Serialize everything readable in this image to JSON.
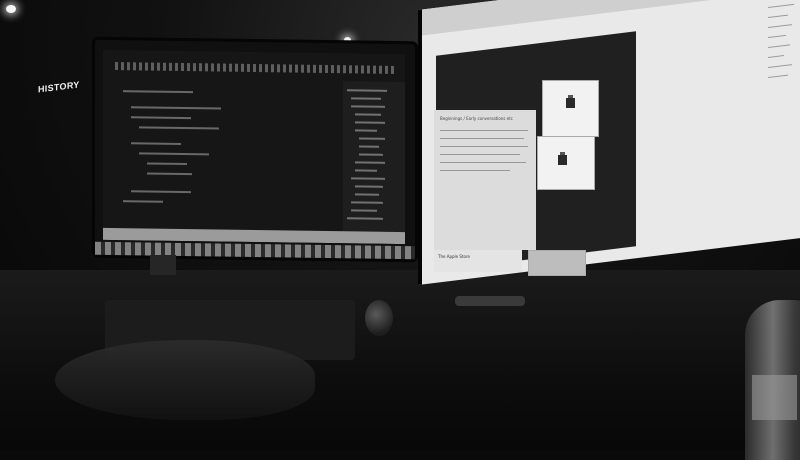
{
  "scene": {
    "description_free": true
  },
  "right_monitor": {
    "page_heading": "HISTORY",
    "card_heading": "Beginnings / Early conversations etc",
    "bottom_card_label": "The Apple Store"
  },
  "colors": {
    "background": "#0a0a0a",
    "screen_light": "#e9e9e9",
    "screen_dark": "#161616"
  }
}
